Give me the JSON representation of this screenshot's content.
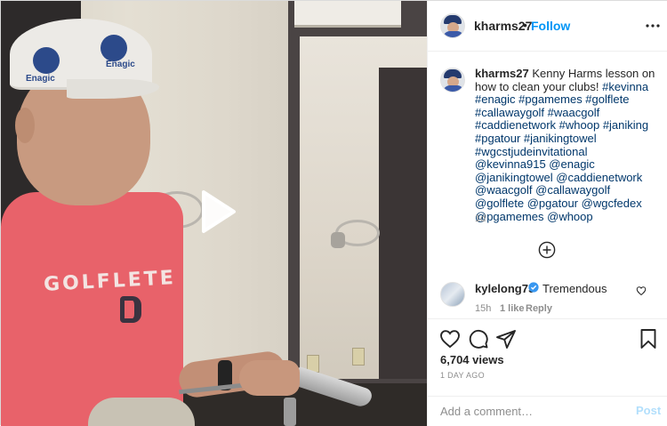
{
  "header": {
    "username": "kharms27",
    "separator": "•",
    "follow_label": "Follow"
  },
  "caption": {
    "username": "kharms27",
    "text": "Kenny Harms lesson on how to clean your clubs!",
    "tags": "#kevinna #enagic #pgamemes #golflete #callawaygolf #waacgolf #caddienetwork #whoop #janiking #pgatour #janikingtowel #wgcstjudeinvitational @kevinna915 @enagic @janikingtowel @caddienetwork @waacgolf @callawaygolf @golflete @pgatour @wgcfedex @pgamemes @whoop",
    "time": "1d"
  },
  "reply": {
    "username": "kylelong75",
    "text": "Tremendous",
    "time": "15h",
    "likes": "1 like",
    "reply_label": "Reply"
  },
  "stats": {
    "views": "6,704 views",
    "date": "1 DAY AGO"
  },
  "add_comment": {
    "placeholder": "Add a comment…",
    "post_label": "Post"
  },
  "video_overlay": {
    "shirt_text": "GOLFLETE",
    "cap_text": "Enagic"
  },
  "colors": {
    "accent": "#0095f6",
    "link": "#00376b",
    "secondary_text": "#8e8e8e",
    "post_disabled": "#b2dffc",
    "verified": "#3897f0"
  },
  "icons": {
    "play": "play-icon",
    "more": "more-options-icon",
    "load_more": "plus-circle-icon",
    "verified": "verified-badge-icon",
    "like": "heart-icon",
    "comment": "comment-icon",
    "share": "share-icon",
    "save": "bookmark-icon"
  }
}
